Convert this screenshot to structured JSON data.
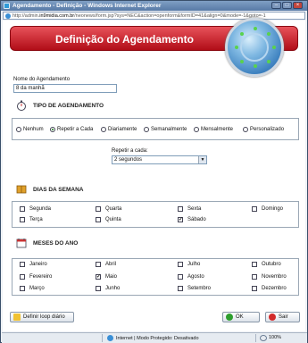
{
  "window": {
    "title": "Agendamento - Definição - Windows Internet Explorer",
    "url_prefix": "http://admin.",
    "url_domain": "in9midia.com.br",
    "url_rest": "/neonews/form.jsp?sys=NEC&action=openform&formID=41&align=0&mode=-1&goto=-1"
  },
  "header": {
    "title": "Definição do Agendamento"
  },
  "form": {
    "name_label": "Nome do Agendamento",
    "name_value": "8 da manhã"
  },
  "schedule_type": {
    "title": "TIPO DE AGENDAMENTO",
    "options": [
      {
        "label": "Nenhum",
        "selected": false
      },
      {
        "label": "Repetir a Cada",
        "selected": true
      },
      {
        "label": "Diariamente",
        "selected": false
      },
      {
        "label": "Semanalmente",
        "selected": false
      },
      {
        "label": "Mensalmente",
        "selected": false
      },
      {
        "label": "Personalizado",
        "selected": false
      }
    ],
    "repeat_label": "Repetir a cada:",
    "repeat_value": "2 segundos"
  },
  "weekdays": {
    "title": "DIAS DA SEMANA",
    "items": [
      {
        "label": "Segunda",
        "checked": false
      },
      {
        "label": "Quarta",
        "checked": false
      },
      {
        "label": "Sexta",
        "checked": false
      },
      {
        "label": "Domingo",
        "checked": false
      },
      {
        "label": "Terça",
        "checked": false
      },
      {
        "label": "Quinta",
        "checked": false
      },
      {
        "label": "Sábado",
        "checked": true
      }
    ]
  },
  "months": {
    "title": "MESES DO ANO",
    "items": [
      {
        "label": "Janeiro",
        "checked": false
      },
      {
        "label": "Abril",
        "checked": false
      },
      {
        "label": "Julho",
        "checked": false
      },
      {
        "label": "Outubro",
        "checked": false
      },
      {
        "label": "Fevereiro",
        "checked": false
      },
      {
        "label": "Maio",
        "checked": true
      },
      {
        "label": "Agosto",
        "checked": false
      },
      {
        "label": "Novembro",
        "checked": false
      },
      {
        "label": "Março",
        "checked": false
      },
      {
        "label": "Junho",
        "checked": false
      },
      {
        "label": "Setembro",
        "checked": false
      },
      {
        "label": "Dezembro",
        "checked": false
      }
    ]
  },
  "buttons": {
    "daily_loop": "Definir loop diário",
    "ok": "OK",
    "exit": "Sair"
  },
  "statusbar": {
    "zone": "Internet | Modo Protegido: Desativado",
    "zoom": "100%"
  },
  "icons": {
    "app": "ie-icon",
    "clock": "clock-icon",
    "calendar": "calendar-icon",
    "ok": "check-icon",
    "exit": "stop-icon"
  },
  "colors": {
    "header_red": "#c8151f",
    "ok_green": "#2e9e2e",
    "exit_red": "#d22a2a",
    "selected_radio": "#1a7a1a"
  }
}
